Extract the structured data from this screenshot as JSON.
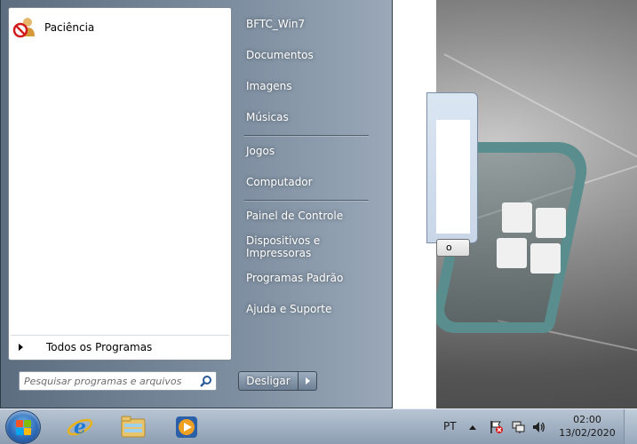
{
  "start_menu": {
    "pinned": [
      {
        "label": "Paciência",
        "icon": "solitaire-icon"
      }
    ],
    "all_programs_label": "Todos os Programas",
    "search": {
      "placeholder": "Pesquisar programas e arquivos",
      "value": ""
    },
    "right_items": [
      {
        "label": "BFTC_Win7",
        "name": "right-item-user"
      },
      {
        "label": "Documentos",
        "name": "right-item-documentos"
      },
      {
        "label": "Imagens",
        "name": "right-item-imagens"
      },
      {
        "label": "Músicas",
        "name": "right-item-musicas"
      },
      {
        "label": "Jogos",
        "name": "right-item-jogos"
      },
      {
        "label": "Computador",
        "name": "right-item-computador"
      },
      {
        "label": "Painel de Controle",
        "name": "right-item-painel-de-controle"
      },
      {
        "label": "Dispositivos e Impressoras",
        "name": "right-item-dispositivos"
      },
      {
        "label": "Programas Padrão",
        "name": "right-item-programas-padrao"
      },
      {
        "label": "Ajuda e Suporte",
        "name": "right-item-ajuda"
      }
    ],
    "shutdown_label": "Desligar"
  },
  "background_dialog": {
    "button_label": "o"
  },
  "taskbar": {
    "pinned_apps": [
      "internet-explorer-icon",
      "windows-explorer-icon",
      "media-player-icon"
    ],
    "language": "PT",
    "tray_icons": [
      "show-hidden-icons-arrow",
      "action-center-flag-icon",
      "network-icon",
      "volume-icon"
    ],
    "time": "02:00",
    "date": "13/02/2020"
  },
  "colors": {
    "start_menu_accent": "#7d8ea0",
    "taskbar": "#a4b3c4",
    "orb": "#2e6bb8"
  }
}
